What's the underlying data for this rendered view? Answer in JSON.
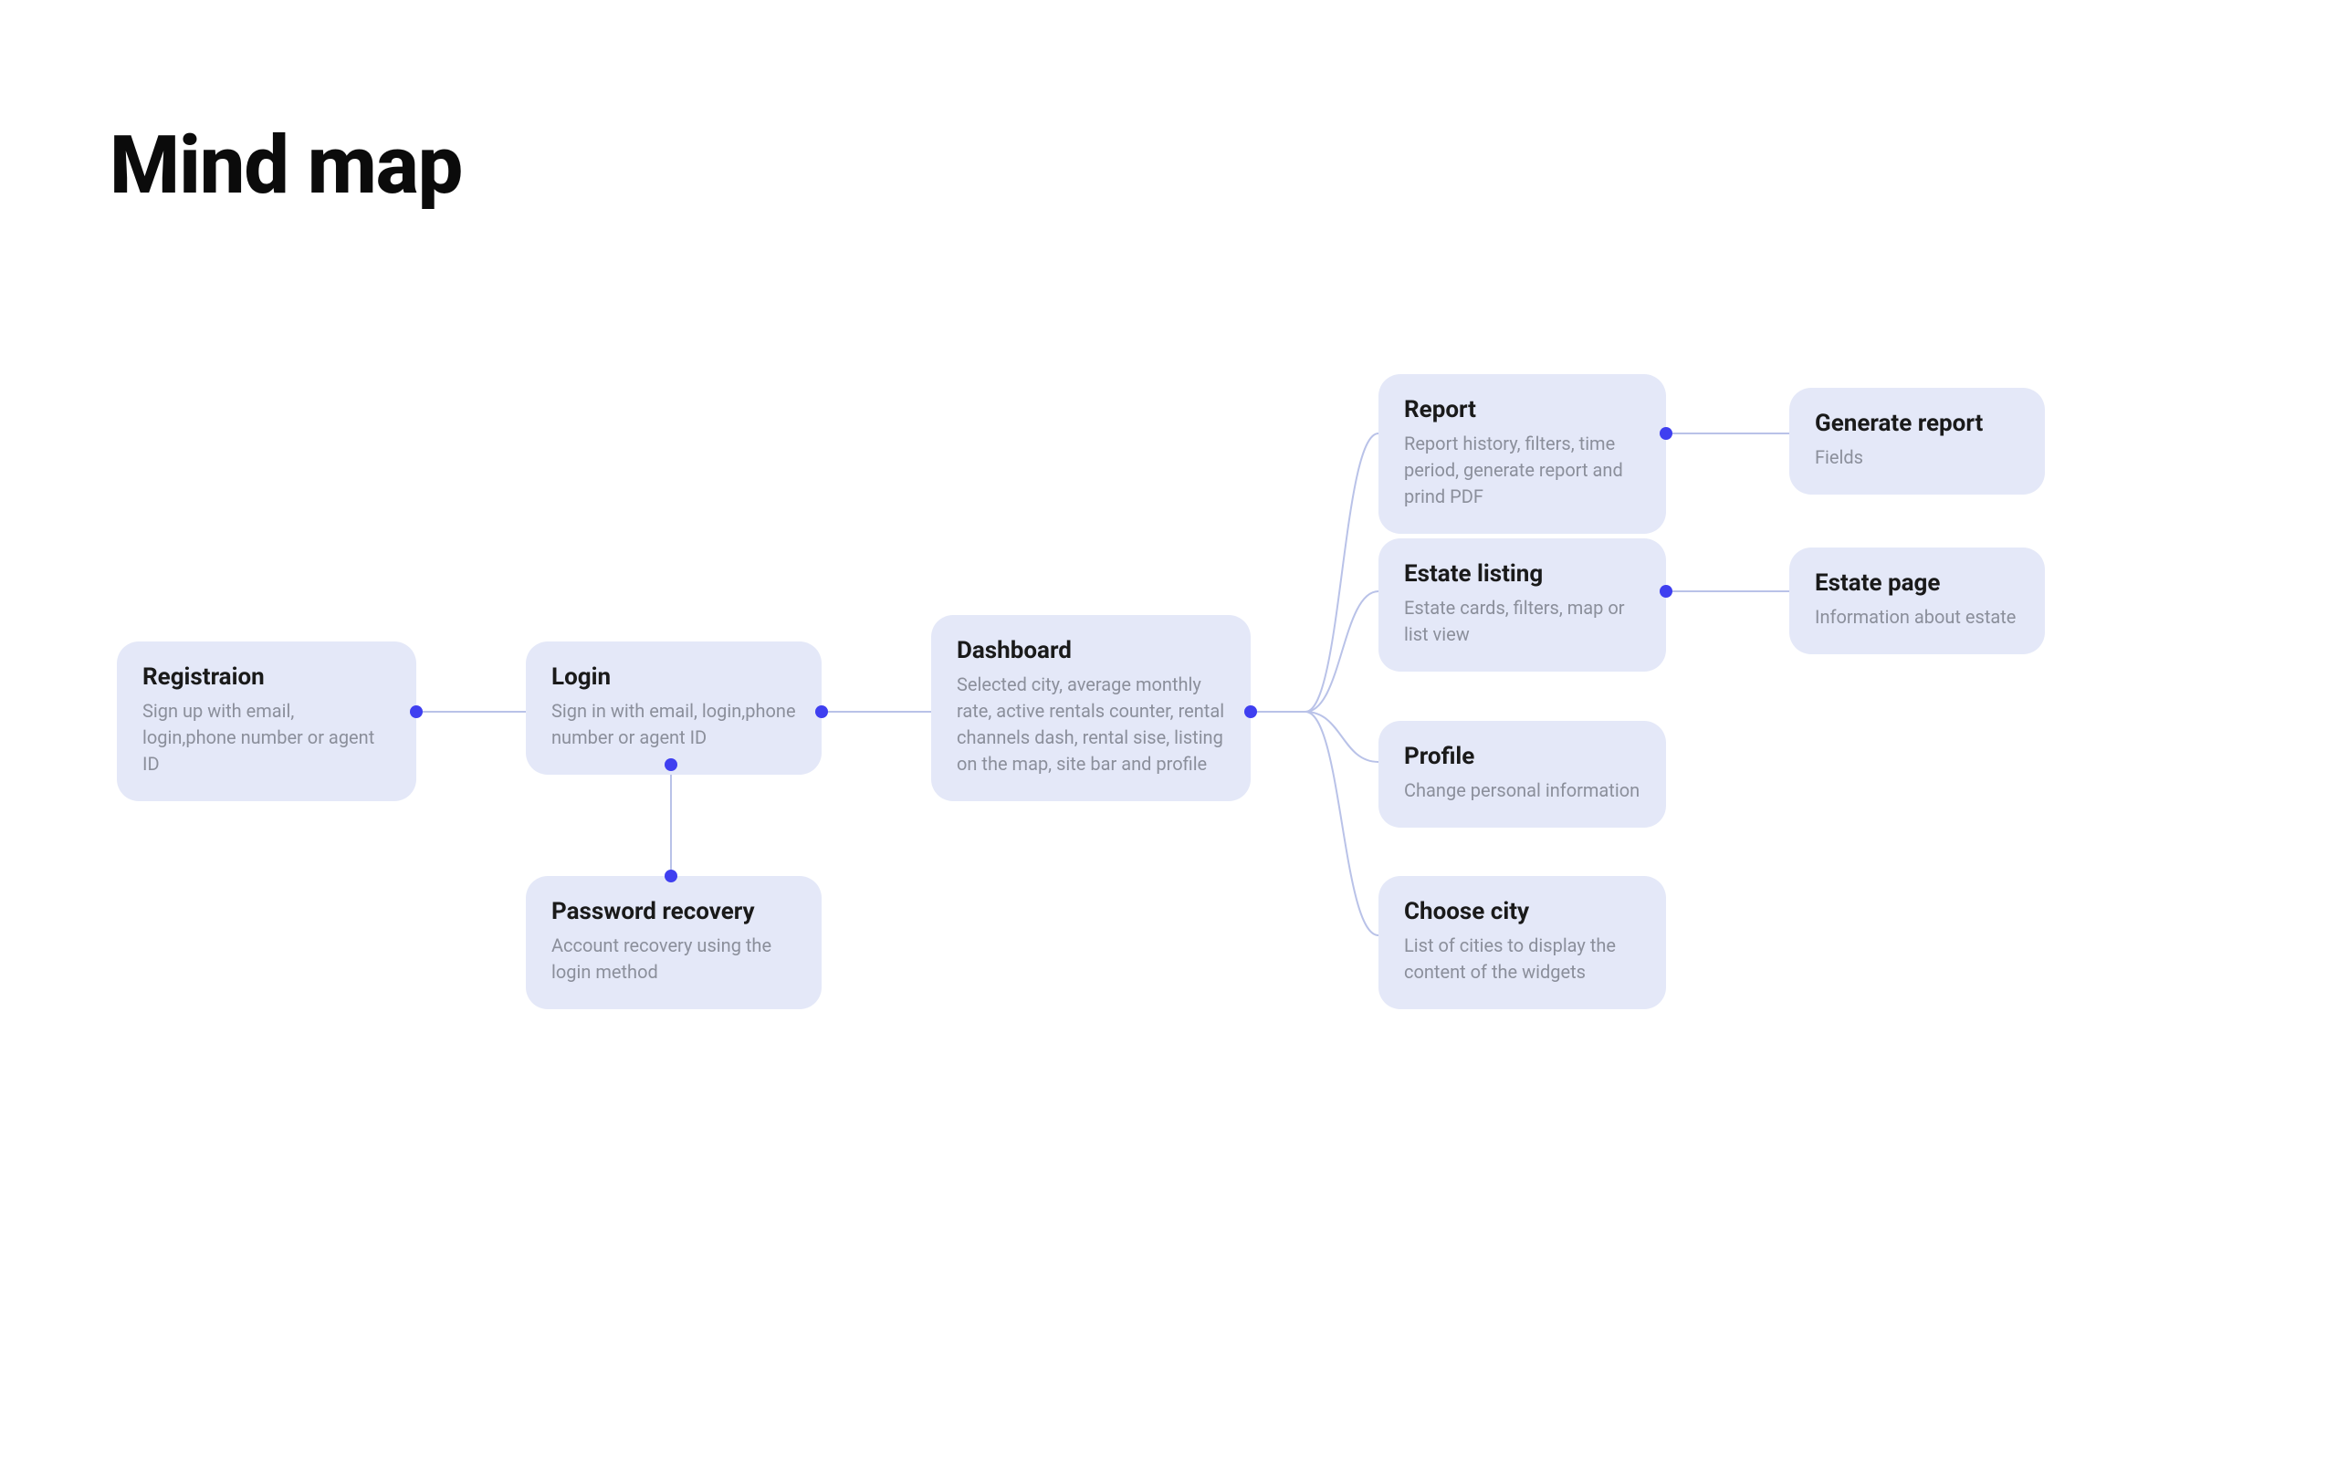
{
  "page": {
    "title": "Mind map"
  },
  "nodes": {
    "registration": {
      "title": "Registraion",
      "desc": "Sign up with email, login,phone number or agent ID"
    },
    "login": {
      "title": "Login",
      "desc": "Sign in with email, login,phone number or agent ID"
    },
    "password_recovery": {
      "title": "Password recovery",
      "desc": "Account recovery using the login method"
    },
    "dashboard": {
      "title": "Dashboard",
      "desc": "Selected city, average monthly rate, active rentals counter, rental channels dash, rental sise, listing on the map, site bar and profile"
    },
    "report": {
      "title": "Report",
      "desc": "Report history, filters, time period, generate report and prind PDF"
    },
    "estate_listing": {
      "title": "Estate listing",
      "desc": "Estate cards, filters, map or list view"
    },
    "profile": {
      "title": "Profile",
      "desc": "Change personal information"
    },
    "choose_city": {
      "title": "Choose city",
      "desc": "List of cities to display the content of the widgets"
    },
    "generate_report": {
      "title": "Generate report",
      "desc": "Fields"
    },
    "estate_page": {
      "title": "Estate page",
      "desc": "Information about estate"
    }
  }
}
